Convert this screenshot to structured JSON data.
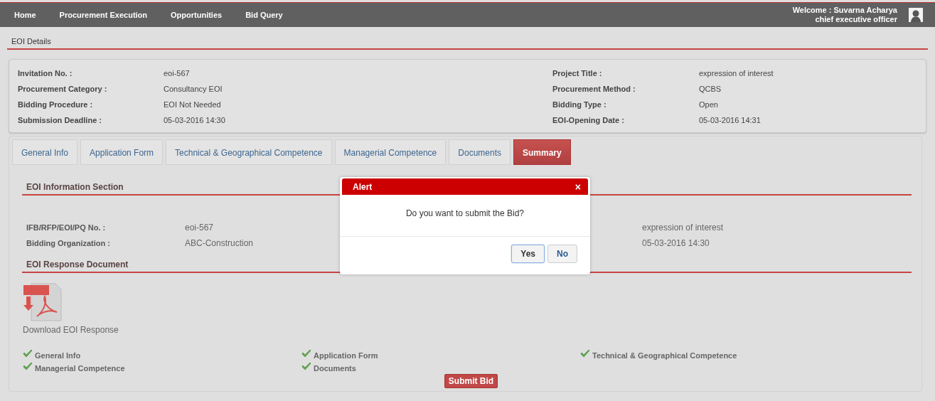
{
  "nav": {
    "items": [
      "Home",
      "Procurement Execution",
      "Opportunities",
      "Bid Query"
    ],
    "welcome_label": "Welcome :",
    "user_name": "Suvarna Acharya",
    "user_role": "chief executive officer"
  },
  "eoi_details": {
    "title": "EOI Details",
    "rows": [
      {
        "label": "Invitation No. :",
        "value": "eoi-567",
        "label_2": "Project Title :",
        "value_2": "expression of interest"
      },
      {
        "label": "Procurement Category :",
        "value": "Consultancy EOI",
        "label_2": "Procurement Method :",
        "value_2": "QCBS"
      },
      {
        "label": "Bidding Procedure :",
        "value": "EOI Not Needed",
        "label_2": "Bidding Type :",
        "value_2": "Open"
      },
      {
        "label": "Submission Deadline :",
        "value": "05-03-2016 14:30",
        "label_2": "EOI-Opening Date :",
        "value_2": "05-03-2016 14:31"
      }
    ]
  },
  "tabs": [
    {
      "label": "General Info",
      "selected": false
    },
    {
      "label": "Application Form",
      "selected": false
    },
    {
      "label": "Technical & Geographical Competence",
      "selected": false
    },
    {
      "label": "Managerial Competence",
      "selected": false
    },
    {
      "label": "Documents",
      "selected": false
    },
    {
      "label": "Summary",
      "selected": true
    }
  ],
  "summary": {
    "info_section": {
      "title": "EOI Information Section",
      "rows": [
        {
          "label": "IFB/RFP/EOI/PQ No. :",
          "value": "eoi-567",
          "column_3": "expression of interest"
        },
        {
          "label": "Bidding Organization :",
          "value": "ABC-Construction",
          "column_3": "05-03-2016 14:30"
        }
      ]
    },
    "response_document": {
      "title": "EOI Response Document",
      "link": "Download EOI Response"
    },
    "checklist": [
      {
        "label": "General Info",
        "checked": true
      },
      {
        "label": "Application Form",
        "checked": true
      },
      {
        "label": "Technical & Geographical Competence",
        "checked": true
      },
      {
        "label": "Managerial Competence",
        "checked": true
      },
      {
        "label": "Documents",
        "checked": true
      }
    ],
    "submit_button": "Submit Bid"
  },
  "dialog": {
    "title": "Alert",
    "close": "×",
    "message": "Do you want to submit the Bid?",
    "buttons": [
      {
        "label": "Yes",
        "focused": true
      },
      {
        "label": "No",
        "focused": false
      }
    ]
  }
}
